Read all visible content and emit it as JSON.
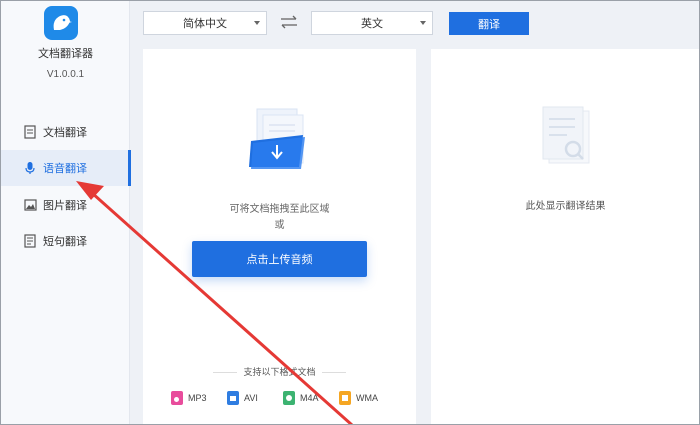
{
  "app": {
    "name": "文档翻译器",
    "version": "V1.0.0.1"
  },
  "nav": [
    {
      "label": "文档翻译",
      "icon": "document-icon"
    },
    {
      "label": "语音翻译",
      "icon": "microphone-icon"
    },
    {
      "label": "图片翻译",
      "icon": "image-icon"
    },
    {
      "label": "短句翻译",
      "icon": "sentence-icon"
    }
  ],
  "nav_active": "语音翻译",
  "toolbar": {
    "source_lang": "简体中文",
    "target_lang": "英文",
    "translate_label": "翻译"
  },
  "upload": {
    "hint_line1": "可将文档拖拽至此区域",
    "hint_line2": "或",
    "button_label": "点击上传音频",
    "formats_title": "支持以下格式文档",
    "formats": [
      "MP3",
      "AVI",
      "M4A",
      "WMA"
    ]
  },
  "result": {
    "hint": "此处显示翻译结果"
  },
  "colors": {
    "accent": "#1f6fe0",
    "annotation_arrow": "#e53935",
    "mp3": "#e84c9c",
    "avi": "#2f7de1",
    "m4a": "#3cb371",
    "wma": "#f5a623"
  }
}
